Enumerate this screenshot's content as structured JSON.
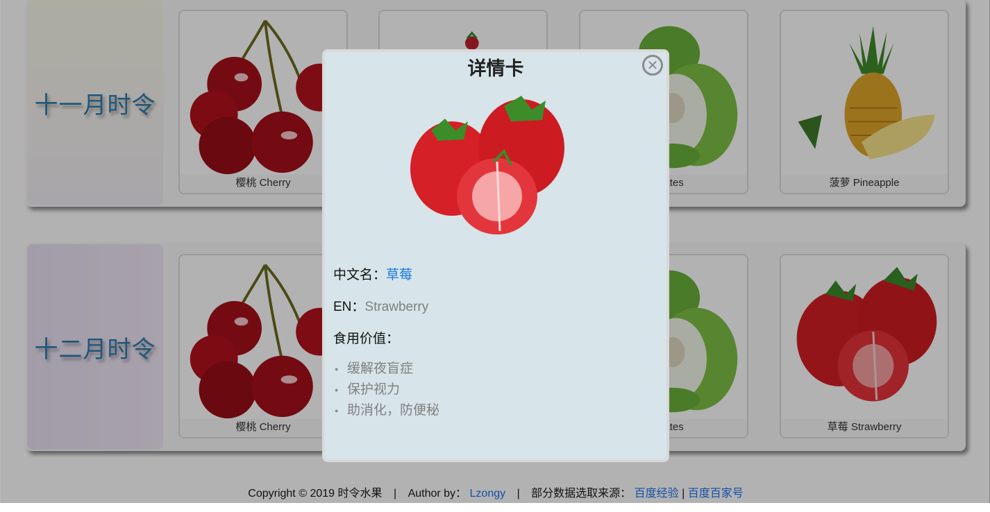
{
  "months": [
    {
      "label": "十一月时令",
      "cards": [
        {
          "name": "樱桃 Cherry",
          "icon": "cherry-image"
        },
        {
          "name": "",
          "icon": "strawberry-image"
        },
        {
          "name": "en dates",
          "icon": "green-dates-image"
        },
        {
          "name": "菠萝 Pineapple",
          "icon": "pineapple-image"
        }
      ]
    },
    {
      "label": "十二月时令",
      "cards": [
        {
          "name": "樱桃 Cherry",
          "icon": "cherry-image"
        },
        {
          "name": "",
          "icon": "strawberry-image"
        },
        {
          "name": "en dates",
          "icon": "green-dates-image"
        },
        {
          "name": "草莓 Strawberry",
          "icon": "strawberry-image"
        }
      ]
    }
  ],
  "modal": {
    "title": "详情卡",
    "close_icon": "close-icon",
    "cn_label": "中文名：",
    "cn_value": "草莓",
    "en_label": "EN：",
    "en_value": "Strawberry",
    "use_label": "食用价值：",
    "uses": [
      "缓解夜盲症",
      "保护视力",
      "助消化，防便秘"
    ]
  },
  "footer": {
    "copyright": "Copyright",
    "copyright_symbol": "©",
    "year_text": "2019 时令水果",
    "divider": "|",
    "author_label": "Author by：",
    "author_link": "Lzongy",
    "source_label": "部分数据选取来源：",
    "source_link1": "百度经验",
    "source_link_sep": "|",
    "source_link2": "百度百家号"
  },
  "colors": {
    "accent_blue": "#1a7ae0",
    "month_label": "#2e7db1",
    "modal_bg": "#d7e4ea"
  }
}
